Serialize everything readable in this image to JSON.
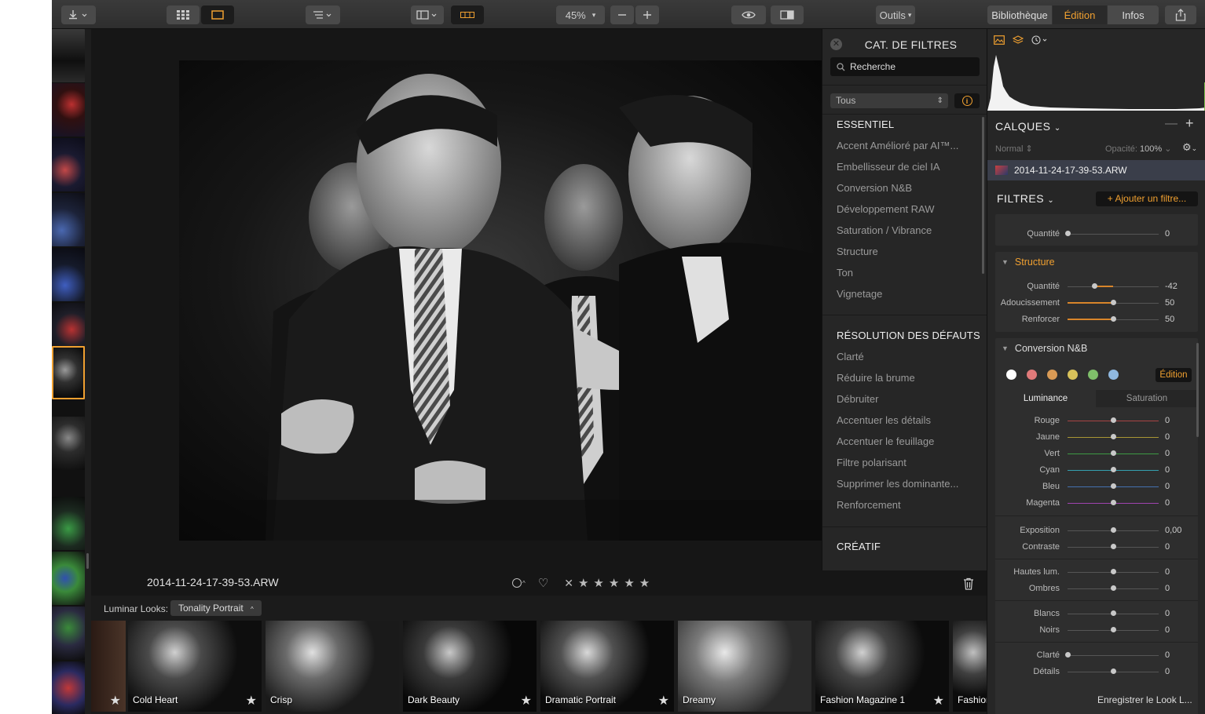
{
  "toolbar": {
    "zoom": "45%",
    "outils": "Outils",
    "tabs": [
      "Bibliothèque",
      "Édition",
      "Infos"
    ],
    "active_tab": "Édition"
  },
  "canvas": {
    "filename": "2014-11-24-17-39-53.ARW"
  },
  "catalog": {
    "title": "CAT. DE FILTRES",
    "search_placeholder": "Recherche",
    "select_value": "Tous",
    "sections": [
      {
        "title": "ESSENTIEL",
        "items": [
          "Accent Amélioré par AI™...",
          "Embellisseur de ciel IA",
          "Conversion N&B",
          "Développement RAW",
          "Saturation / Vibrance",
          "Structure",
          "Ton",
          "Vignetage"
        ]
      },
      {
        "title": "RÉSOLUTION DES DÉFAUTS",
        "items": [
          "Clarté",
          "Réduire la brume",
          "Débruiter",
          "Accentuer les détails",
          "Accentuer le feuillage",
          "Filtre polarisant",
          "Supprimer les dominante...",
          "Renforcement"
        ]
      },
      {
        "title": "CRÉATIF",
        "items": []
      }
    ]
  },
  "looks": {
    "label": "Luminar Looks:",
    "preset": "Tonality Portrait",
    "items": [
      "Cold Heart",
      "Crisp",
      "Dark Beauty",
      "Dramatic Portrait",
      "Dreamy",
      "Fashion Magazine 1",
      "Fashion"
    ]
  },
  "right": {
    "layers_title": "CALQUES",
    "blend_mode": "Normal",
    "opacity_label": "Opacité:",
    "opacity_value": "100%",
    "layer_name": "2014-11-24-17-39-53.ARW",
    "filters_title": "FILTRES",
    "add_filter": "+ Ajouter un filtre...",
    "top_row": {
      "label": "Quantité",
      "value": "0"
    },
    "structure": {
      "title": "Structure",
      "rows": [
        {
          "label": "Quantité",
          "value": "-42",
          "level": -42
        },
        {
          "label": "Adoucissement",
          "value": "50",
          "level": 50
        },
        {
          "label": "Renforcer",
          "value": "50",
          "level": 50
        }
      ]
    },
    "bw": {
      "title": "Conversion N&B",
      "edit_button": "Édition",
      "color_dots": [
        "#ffffff",
        "#e07a7a",
        "#d99a55",
        "#d8c25a",
        "#7fbf6a",
        "#8fb8e0"
      ],
      "tabs": [
        "Luminance",
        "Saturation"
      ],
      "luminance": [
        {
          "label": "Rouge",
          "value": "0",
          "color": "#c94c4c"
        },
        {
          "label": "Jaune",
          "value": "0",
          "color": "#c9b23c"
        },
        {
          "label": "Vert",
          "value": "0",
          "color": "#4caf50"
        },
        {
          "label": "Cyan",
          "value": "0",
          "color": "#3cb3c9"
        },
        {
          "label": "Bleu",
          "value": "0",
          "color": "#4c7cc9"
        },
        {
          "label": "Magenta",
          "value": "0",
          "color": "#b84cc9"
        }
      ],
      "tone": [
        {
          "label": "Exposition",
          "value": "0,00"
        },
        {
          "label": "Contraste",
          "value": "0"
        },
        {
          "label": "Hautes lum.",
          "value": "0"
        },
        {
          "label": "Ombres",
          "value": "0"
        },
        {
          "label": "Blancs",
          "value": "0"
        },
        {
          "label": "Noirs",
          "value": "0"
        },
        {
          "label": "Clarté",
          "value": "0"
        },
        {
          "label": "Détails",
          "value": "0"
        }
      ]
    },
    "save_look": "Enregistrer le Look L..."
  }
}
